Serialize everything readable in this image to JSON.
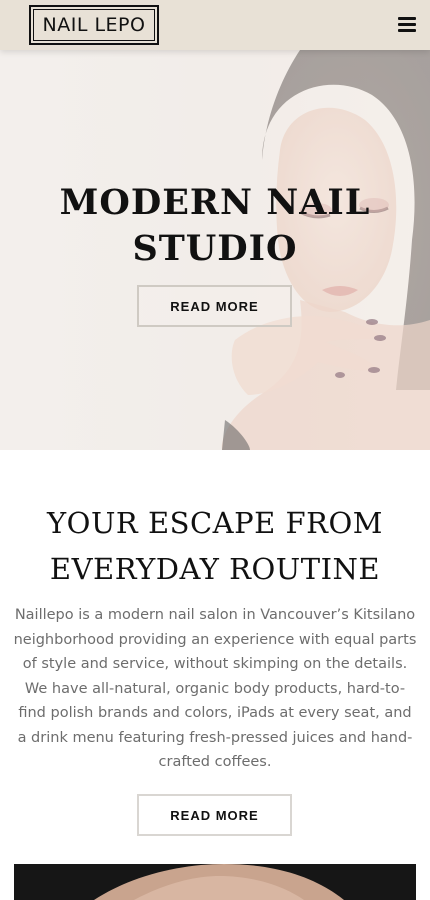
{
  "header": {
    "logo_text": "NAIL LEPO",
    "menu_icon": "hamburger-menu-icon"
  },
  "hero": {
    "title_line1": "MODERN NAIL",
    "title_line2": "STUDIO",
    "button_label": "READ MORE"
  },
  "intro": {
    "title_line1": "YOUR ESCAPE FROM",
    "title_line2": "EVERYDAY ROUTINE",
    "paragraph": "Naillepo is a modern nail salon in Vancouver’s Kitsilano neighborhood providing an experience with equal parts of style and service, without skimping on the details. We have all-natural, organic body products, hard-to-find polish brands and colors, iPads at every seat, and a drink menu featuring fresh-pressed juices and hand-crafted coffees.",
    "button_label": "READ MORE"
  },
  "colors": {
    "header_bg": "#e8e1d6",
    "text_dark": "#111111",
    "body_text": "#6d6d6d",
    "button_border": "#cfcac3"
  }
}
